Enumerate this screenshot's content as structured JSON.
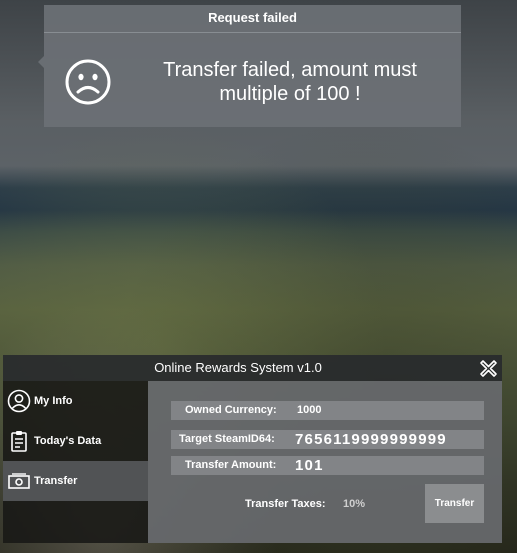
{
  "notification": {
    "title": "Request failed",
    "icon": "sad-face-icon",
    "message_line1": "Transfer failed, amount must",
    "message_line2": "multiple of 100 !"
  },
  "panel": {
    "title": "Online Rewards System v1.0",
    "close_icon": "close-icon",
    "sidebar": {
      "items": [
        {
          "label": "My Info",
          "icon": "user-circle-icon",
          "active": false
        },
        {
          "label": "Today's Data",
          "icon": "clipboard-icon",
          "active": false
        },
        {
          "label": "Transfer",
          "icon": "banknote-icon",
          "active": true
        }
      ]
    },
    "content": {
      "owned_currency_label": "Owned Currency:",
      "owned_currency_value": "1000",
      "target_steamid_label": "Target SteamID64:",
      "target_steamid_value": "7656119999999999",
      "transfer_amount_label": "Transfer Amount:",
      "transfer_amount_value": "101",
      "transfer_taxes_label": "Transfer Taxes:",
      "transfer_taxes_value": "10%",
      "transfer_button_label": "Transfer"
    }
  }
}
